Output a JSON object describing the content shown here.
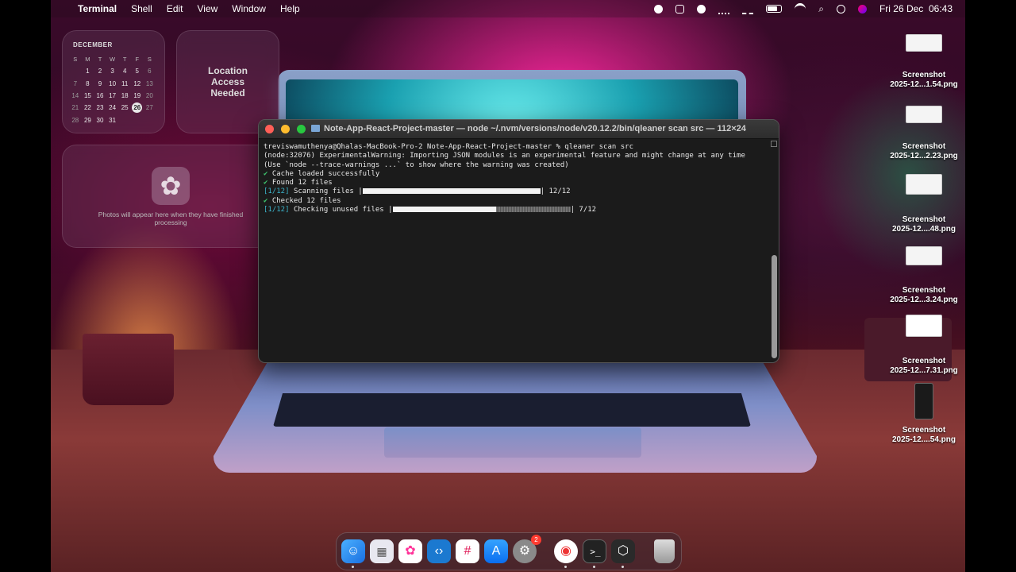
{
  "menubar": {
    "app": "Terminal",
    "items": [
      "Shell",
      "Edit",
      "View",
      "Window",
      "Help"
    ],
    "datetime": "Fri 26 Dec  06:43"
  },
  "widgets": {
    "calendar": {
      "month": "DECEMBER",
      "weekdays": [
        "S",
        "M",
        "T",
        "W",
        "T",
        "F",
        "S"
      ],
      "weeks": [
        [
          "",
          "1",
          "2",
          "3",
          "4",
          "5",
          "6"
        ],
        [
          "7",
          "8",
          "9",
          "10",
          "11",
          "12",
          "13"
        ],
        [
          "14",
          "15",
          "16",
          "17",
          "18",
          "19",
          "20"
        ],
        [
          "21",
          "22",
          "23",
          "24",
          "25",
          "26",
          "27"
        ],
        [
          "28",
          "29",
          "30",
          "31",
          "",
          "",
          ""
        ]
      ],
      "today": "26"
    },
    "location": "Location Access Needed",
    "photos": "Photos will appear here when they have finished processing"
  },
  "terminal": {
    "title": "Note-App-React-Project-master — node ~/.nvm/versions/node/v20.12.2/bin/qleaner scan src — 112×24",
    "lines": {
      "prompt": "treviswamuthenya@Qhalas-MacBook-Pro-2 Note-App-React-Project-master % qleaner scan src",
      "warn1": "(node:32076) ExperimentalWarning: Importing JSON modules is an experimental feature and might change at any time",
      "warn2": "(Use `node --trace-warnings ...` to show where the warning was created)",
      "cache": "Cache loaded successfully",
      "found": "Found 12 files",
      "scan_step": "[1/12]",
      "scan_label": "Scanning files",
      "scan_count": "12/12",
      "checked": "Checked 12 files",
      "check_step": "[1/12]",
      "check_label": "Checking unused files",
      "check_count": "7/12"
    },
    "check_mark": "✔",
    "progress": {
      "scan": 1.0,
      "check": 0.5833
    }
  },
  "desktop_icons": [
    {
      "l1": "Screenshot",
      "l2": "2025-12...1.54.png"
    },
    {
      "l1": "Screenshot",
      "l2": "2025-12...2.23.png"
    },
    {
      "l1": "Screenshot",
      "l2": "2025-12....48.png"
    },
    {
      "l1": "Screenshot",
      "l2": "2025-12...3.24.png"
    },
    {
      "l1": "Screenshot",
      "l2": "2025-12...7.31.png"
    },
    {
      "l1": "Screenshot",
      "l2": "2025-12....54.png"
    }
  ],
  "dock": {
    "settings_badge": "2",
    "apps": [
      "finder-icon",
      "launchpad-icon",
      "photos-icon",
      "vscode-icon",
      "slack-icon",
      "appstore-icon",
      "settings-icon",
      "chrome-icon",
      "terminal-icon",
      "cube-app-icon",
      "trash-icon"
    ]
  },
  "colors": {
    "ok": "#3ec46d",
    "step": "#3bb3c9",
    "close": "#ff5f57",
    "minimize": "#febc2e",
    "zoom": "#28c840"
  }
}
